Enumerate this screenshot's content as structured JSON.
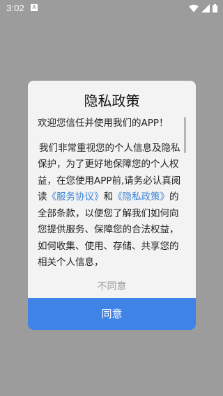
{
  "status_bar": {
    "time": "3:02",
    "notification_badge": "A"
  },
  "dialog": {
    "title": "隐私政策",
    "greeting": "欢迎您信任并使用我们的APP！",
    "body_part1": "我们非常重视您的个人信息及隐私保护，为了更好地保障您的个人权益，在您使用APP前,请务必认真阅读",
    "link_service": "《服务协议》",
    "conjunction": "和",
    "link_privacy": "《隐私政策》",
    "body_part2": "的全部条款，以便您了解我们如何向您提供服务、保障您的合法权益，如何收集、使用、存储、共享您的相关个人信息，",
    "decline_label": "不同意",
    "agree_label": "同意"
  },
  "colors": {
    "overlay": "#9c9c9c",
    "dialog_bg": "#f3f3f3",
    "accent": "#3f83e6",
    "link": "#3b82d6",
    "muted": "#9e9e9e"
  },
  "icons": [
    "wifi-icon",
    "signal-icon",
    "battery-icon",
    "scrollbar-thumb"
  ]
}
